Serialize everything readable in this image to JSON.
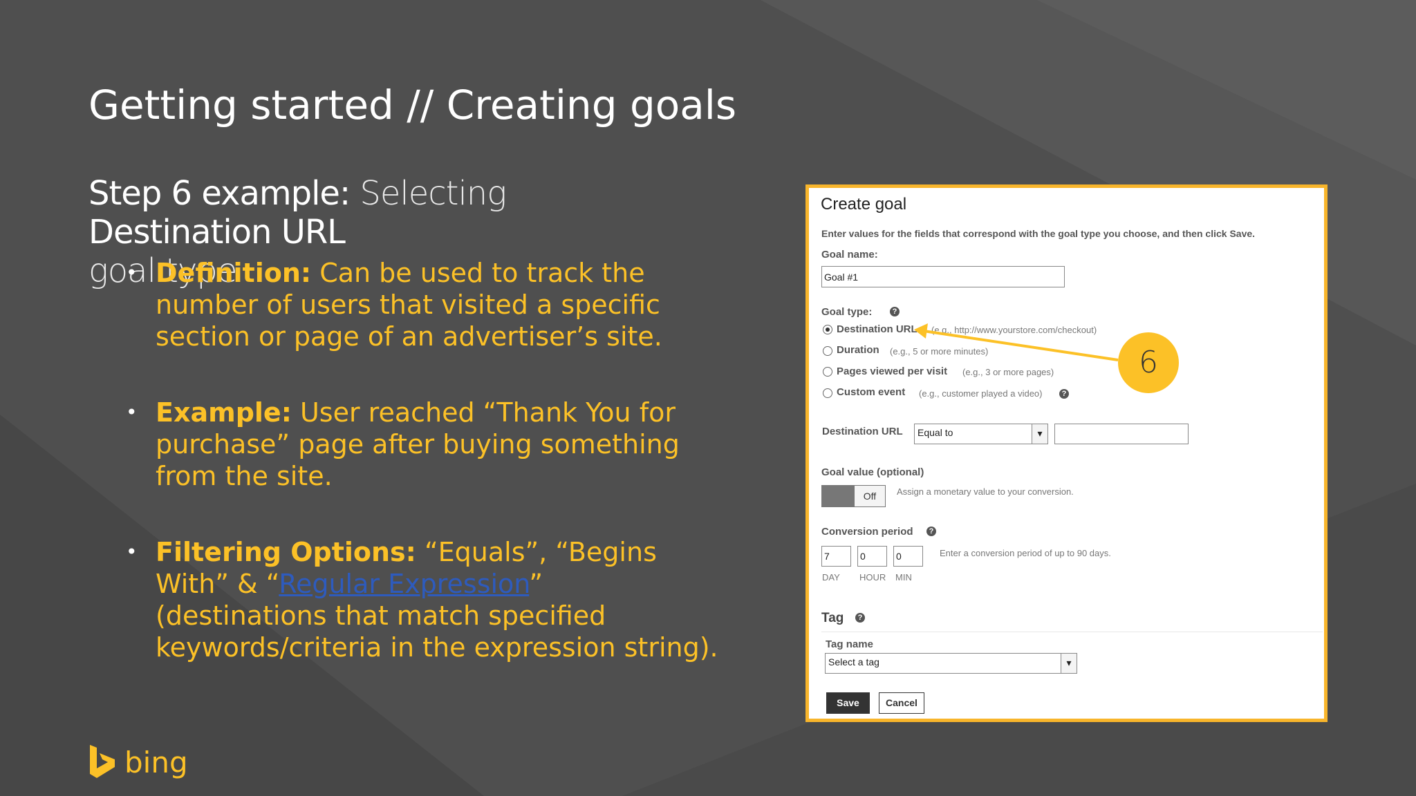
{
  "slide": {
    "title": "Getting started // Creating goals",
    "subtitle": {
      "part1": "Step 6 example:",
      "part2": " Selecting ",
      "part3": "Destination URL",
      "part4": "goal type"
    },
    "bullets": [
      {
        "lead": "Definition:",
        "text": " Can be used to track the number of users that visited a specific section or page of an advertiser’s site."
      },
      {
        "lead": "Example:",
        "text": " User reached “Thank You for purchase” page after buying something from the site."
      },
      {
        "lead": "Filtering Options:",
        "text_before_link": " “Equals”, “Begins With” & “",
        "link": "Regular Expression",
        "text_after_link": "” (destinations that match specified keywords/criteria in the expression string)."
      }
    ],
    "logo_text": "bing",
    "callout_number": "6",
    "colors": {
      "accent": "#fcc127",
      "background": "#4f4f4f",
      "link": "#2e5bbd"
    }
  },
  "dialog": {
    "title": "Create goal",
    "description": "Enter values for the fields that correspond with the goal type you choose, and then click Save.",
    "goal_name_label": "Goal name:",
    "goal_name_value": "Goal #1",
    "goal_type_label": "Goal type:",
    "goal_types": [
      {
        "label": "Destination URL",
        "hint": "(e.g., http://www.yourstore.com/checkout)",
        "selected": true
      },
      {
        "label": "Duration",
        "hint": "(e.g., 5 or more minutes)",
        "selected": false
      },
      {
        "label": "Pages viewed per visit",
        "hint": "(e.g., 3 or more pages)",
        "selected": false
      },
      {
        "label": "Custom event",
        "hint": "(e.g., customer played a video)",
        "selected": false
      }
    ],
    "destination_url_label": "Destination URL",
    "destination_operator": "Equal to",
    "destination_value": "",
    "goal_value_label": "Goal value (optional)",
    "toggle_state": "Off",
    "goal_value_hint": "Assign a monetary value to your conversion.",
    "conversion_period_label": "Conversion period",
    "period_day": "7",
    "period_hour": "0",
    "period_min": "0",
    "unit_day": "DAY",
    "unit_hour": "HOUR",
    "unit_min": "MIN",
    "period_hint": "Enter a conversion period of up to 90 days.",
    "tag_header": "Tag",
    "tag_name_label": "Tag name",
    "tag_select_value": "Select a tag",
    "save_label": "Save",
    "cancel_label": "Cancel",
    "help_glyph": "?"
  }
}
